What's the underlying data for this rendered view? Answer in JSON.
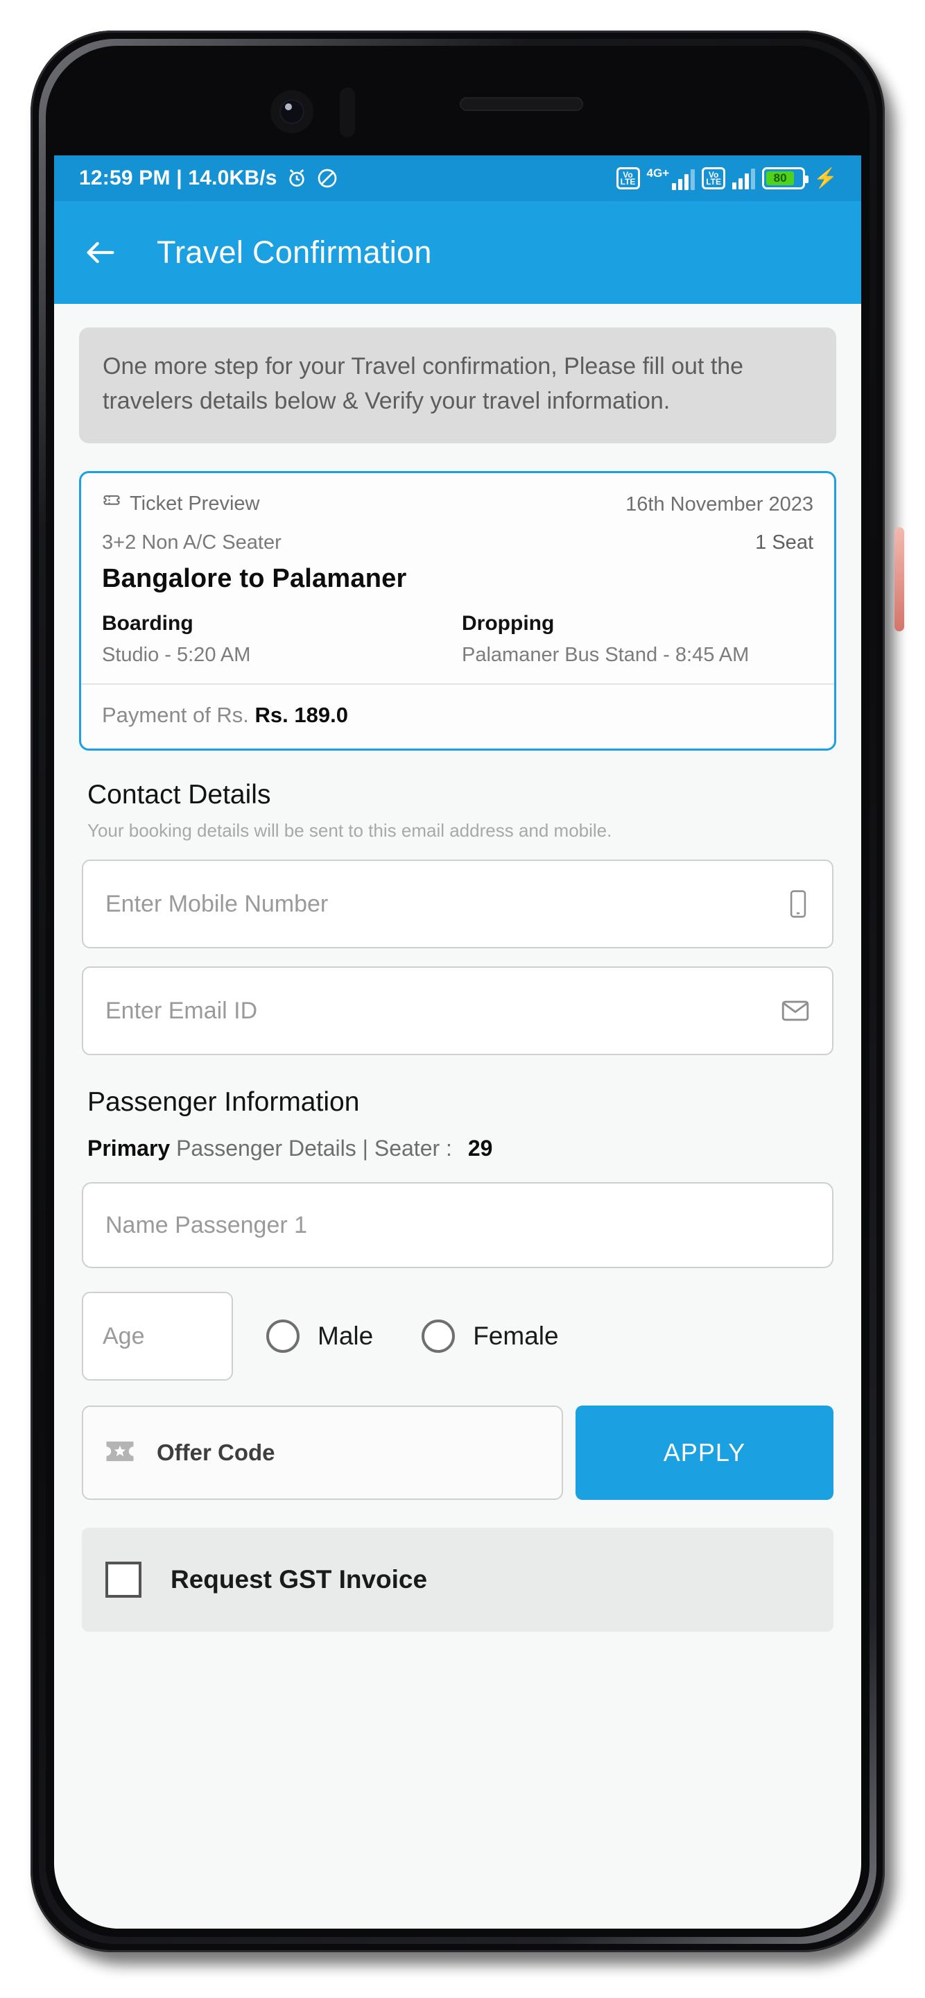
{
  "statusbar": {
    "time_and_speed": "12:59 PM | 14.0KB/s",
    "alarm_icon": "alarm-icon",
    "dnd_icon": "do-not-disturb-icon",
    "volte_top": "Vo",
    "volte_bottom": "LTE",
    "network_label": "4G+",
    "battery_level": "80",
    "charging_icon": "charging-bolt-icon"
  },
  "appbar": {
    "back_icon": "back-arrow-icon",
    "title": "Travel Confirmation"
  },
  "notice": {
    "text": "One more step for your Travel confirmation, Please fill out the travelers details below & Verify your travel information."
  },
  "ticket": {
    "preview_icon": "ticket-preview-icon",
    "preview_label": "Ticket Preview",
    "date": "16th November 2023",
    "seat_type": "3+2 Non A/C Seater",
    "seat_count": "1 Seat",
    "route": "Bangalore to Palamaner",
    "boarding_title": "Boarding",
    "boarding_value": "Studio - 5:20 AM",
    "dropping_title": "Dropping",
    "dropping_value": "Palamaner  Bus Stand - 8:45 AM",
    "payment_prefix": "Payment of Rs.",
    "payment_amount": "Rs. 189.0"
  },
  "contact": {
    "title": "Contact Details",
    "subtitle": "Your booking details will be sent to this email address and mobile.",
    "mobile_placeholder": "Enter Mobile Number",
    "mobile_icon": "mobile-phone-icon",
    "email_placeholder": "Enter Email ID",
    "email_icon": "envelope-icon"
  },
  "passenger": {
    "title": "Passenger Information",
    "primary_label": "Primary",
    "details_label": "Passenger Details | Seater :",
    "seat_number": "29",
    "name_placeholder": "Name Passenger 1",
    "age_placeholder": "Age",
    "male_label": "Male",
    "female_label": "Female"
  },
  "offer": {
    "icon": "offer-ticket-icon",
    "placeholder": "Offer Code",
    "apply_label": "APPLY"
  },
  "gst": {
    "checkbox_icon": "checkbox-unchecked-icon",
    "label": "Request GST Invoice"
  },
  "colors": {
    "accent": "#1ba1e2",
    "statusbar": "#1592d4",
    "battery_green": "#4fd21c"
  }
}
